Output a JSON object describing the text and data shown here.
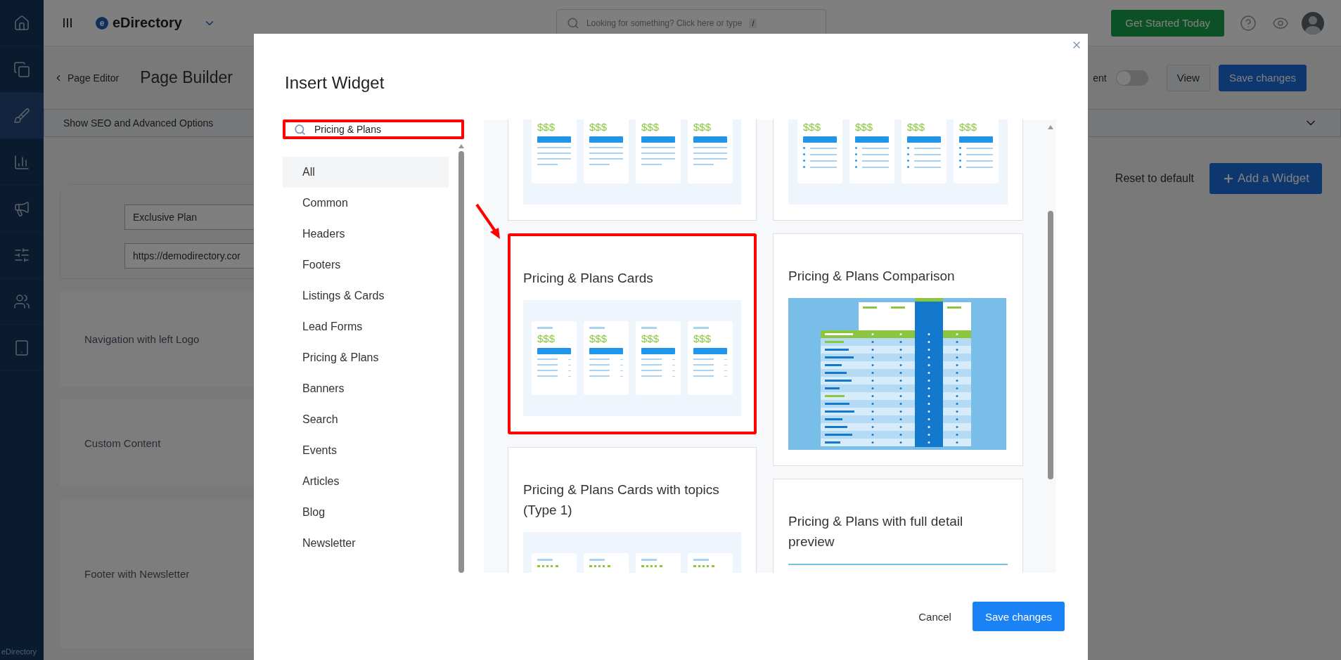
{
  "sidebar": {
    "items": [
      {
        "selected": false
      },
      {
        "selected": false
      },
      {
        "selected": true
      },
      {
        "selected": false
      },
      {
        "selected": false
      },
      {
        "selected": false
      },
      {
        "selected": false
      },
      {
        "selected": false
      }
    ],
    "footer": "eDirectory"
  },
  "topbar": {
    "logo": {
      "mark": "e",
      "name": "eDirectory"
    },
    "search": {
      "placeholder": "Looking for something? Click here or type",
      "shortcut": "/"
    },
    "cta": "Get Started Today"
  },
  "editor_bar": {
    "back": "Page Editor",
    "title": "Page Builder",
    "toggle": {
      "label": "ent",
      "on": false
    },
    "buttons": [
      {
        "label": "View",
        "kind": "secondary"
      },
      {
        "label": "Save changes",
        "kind": "primary"
      }
    ]
  },
  "seo_bar": {
    "label": "Show SEO and Advanced Options",
    "expanded": false
  },
  "content": {
    "fields": [
      {
        "value": "Exclusive Plan"
      },
      {
        "value": "https://demodirectory.cor"
      }
    ],
    "reset": "Reset to default",
    "add": "Add a Widget",
    "sections": [
      "Navigation with left Logo",
      "Custom Content",
      "Footer with Newsletter"
    ]
  },
  "modal": {
    "title": "Insert Widget",
    "search": {
      "value": "Pricing & Plans",
      "highlighted": true
    },
    "categories": [
      {
        "label": "All",
        "selected": true
      },
      {
        "label": "Common",
        "selected": false
      },
      {
        "label": "Headers",
        "selected": false
      },
      {
        "label": "Footers",
        "selected": false
      },
      {
        "label": "Listings & Cards",
        "selected": false
      },
      {
        "label": "Lead Forms",
        "selected": false
      },
      {
        "label": "Pricing & Plans",
        "selected": false
      },
      {
        "label": "Banners",
        "selected": false
      },
      {
        "label": "Search",
        "selected": false
      },
      {
        "label": "Events",
        "selected": false
      },
      {
        "label": "Articles",
        "selected": false
      },
      {
        "label": "Blog",
        "selected": false
      },
      {
        "label": "Newsletter",
        "selected": false
      }
    ],
    "widgets": [
      {
        "preview": {
          "kind": "cards",
          "prices": [
            "$$$",
            "$$$",
            "$$$",
            "$$$"
          ]
        },
        "highlighted": false
      },
      {
        "preview": {
          "kind": "cards-bullets",
          "prices": [
            "$$$",
            "$$$",
            "$$$",
            "$$$"
          ]
        },
        "highlighted": false
      },
      {
        "title": "Pricing & Plans Cards",
        "preview": {
          "kind": "cards-plus",
          "prices": [
            "$$$",
            "$$$",
            "$$$",
            "$$$"
          ]
        },
        "highlighted": true
      },
      {
        "title": "Pricing & Plans Comparison",
        "preview": {
          "kind": "comparison"
        },
        "highlighted": false
      },
      {
        "title": "Pricing & Plans Cards with topics (Type 1)",
        "preview": {
          "kind": "topics"
        },
        "highlighted": false
      },
      {
        "title": "Pricing & Plans with full detail preview",
        "preview": {
          "kind": "detail"
        },
        "highlighted": false
      }
    ],
    "footer": {
      "cancel": "Cancel",
      "save": "Save changes"
    }
  }
}
